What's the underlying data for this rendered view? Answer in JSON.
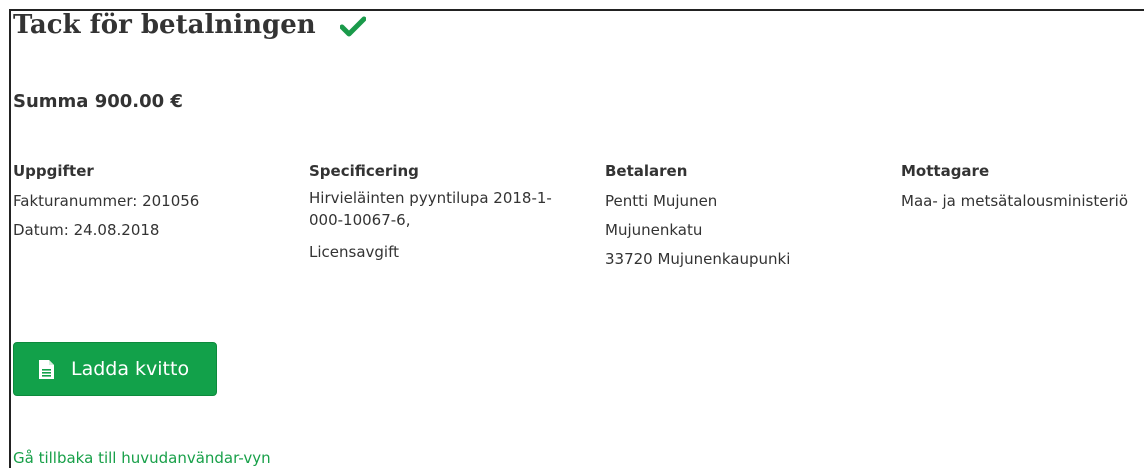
{
  "header": {
    "title": "Tack för betalningen",
    "icon": "check-icon",
    "icon_color": "#1a9a4a"
  },
  "summary": {
    "sum_label": "Summa 900.00 €"
  },
  "details": {
    "info": {
      "heading": "Uppgifter",
      "invoice_number": "Fakturanummer: 201056",
      "date": "Datum: 24.08.2018"
    },
    "specification": {
      "heading": "Specificering",
      "line1": "Hirvieläinten pyyntilupa 2018-1-000-10067-6,",
      "line2": "Licensavgift"
    },
    "payer": {
      "heading": "Betalaren",
      "name": "Pentti Mujunen",
      "street": "Mujunenkatu",
      "postal": "33720 Mujunenkaupunki"
    },
    "recipient": {
      "heading": "Mottagare",
      "name": "Maa- ja metsätalousministeriö"
    }
  },
  "actions": {
    "download_label": "Ladda kvitto",
    "download_icon": "document-icon",
    "back_link": "Gå tillbaka till huvudanvändar-vyn"
  },
  "colors": {
    "accent": "#12a14a",
    "link": "#18a049",
    "text": "#333333"
  }
}
